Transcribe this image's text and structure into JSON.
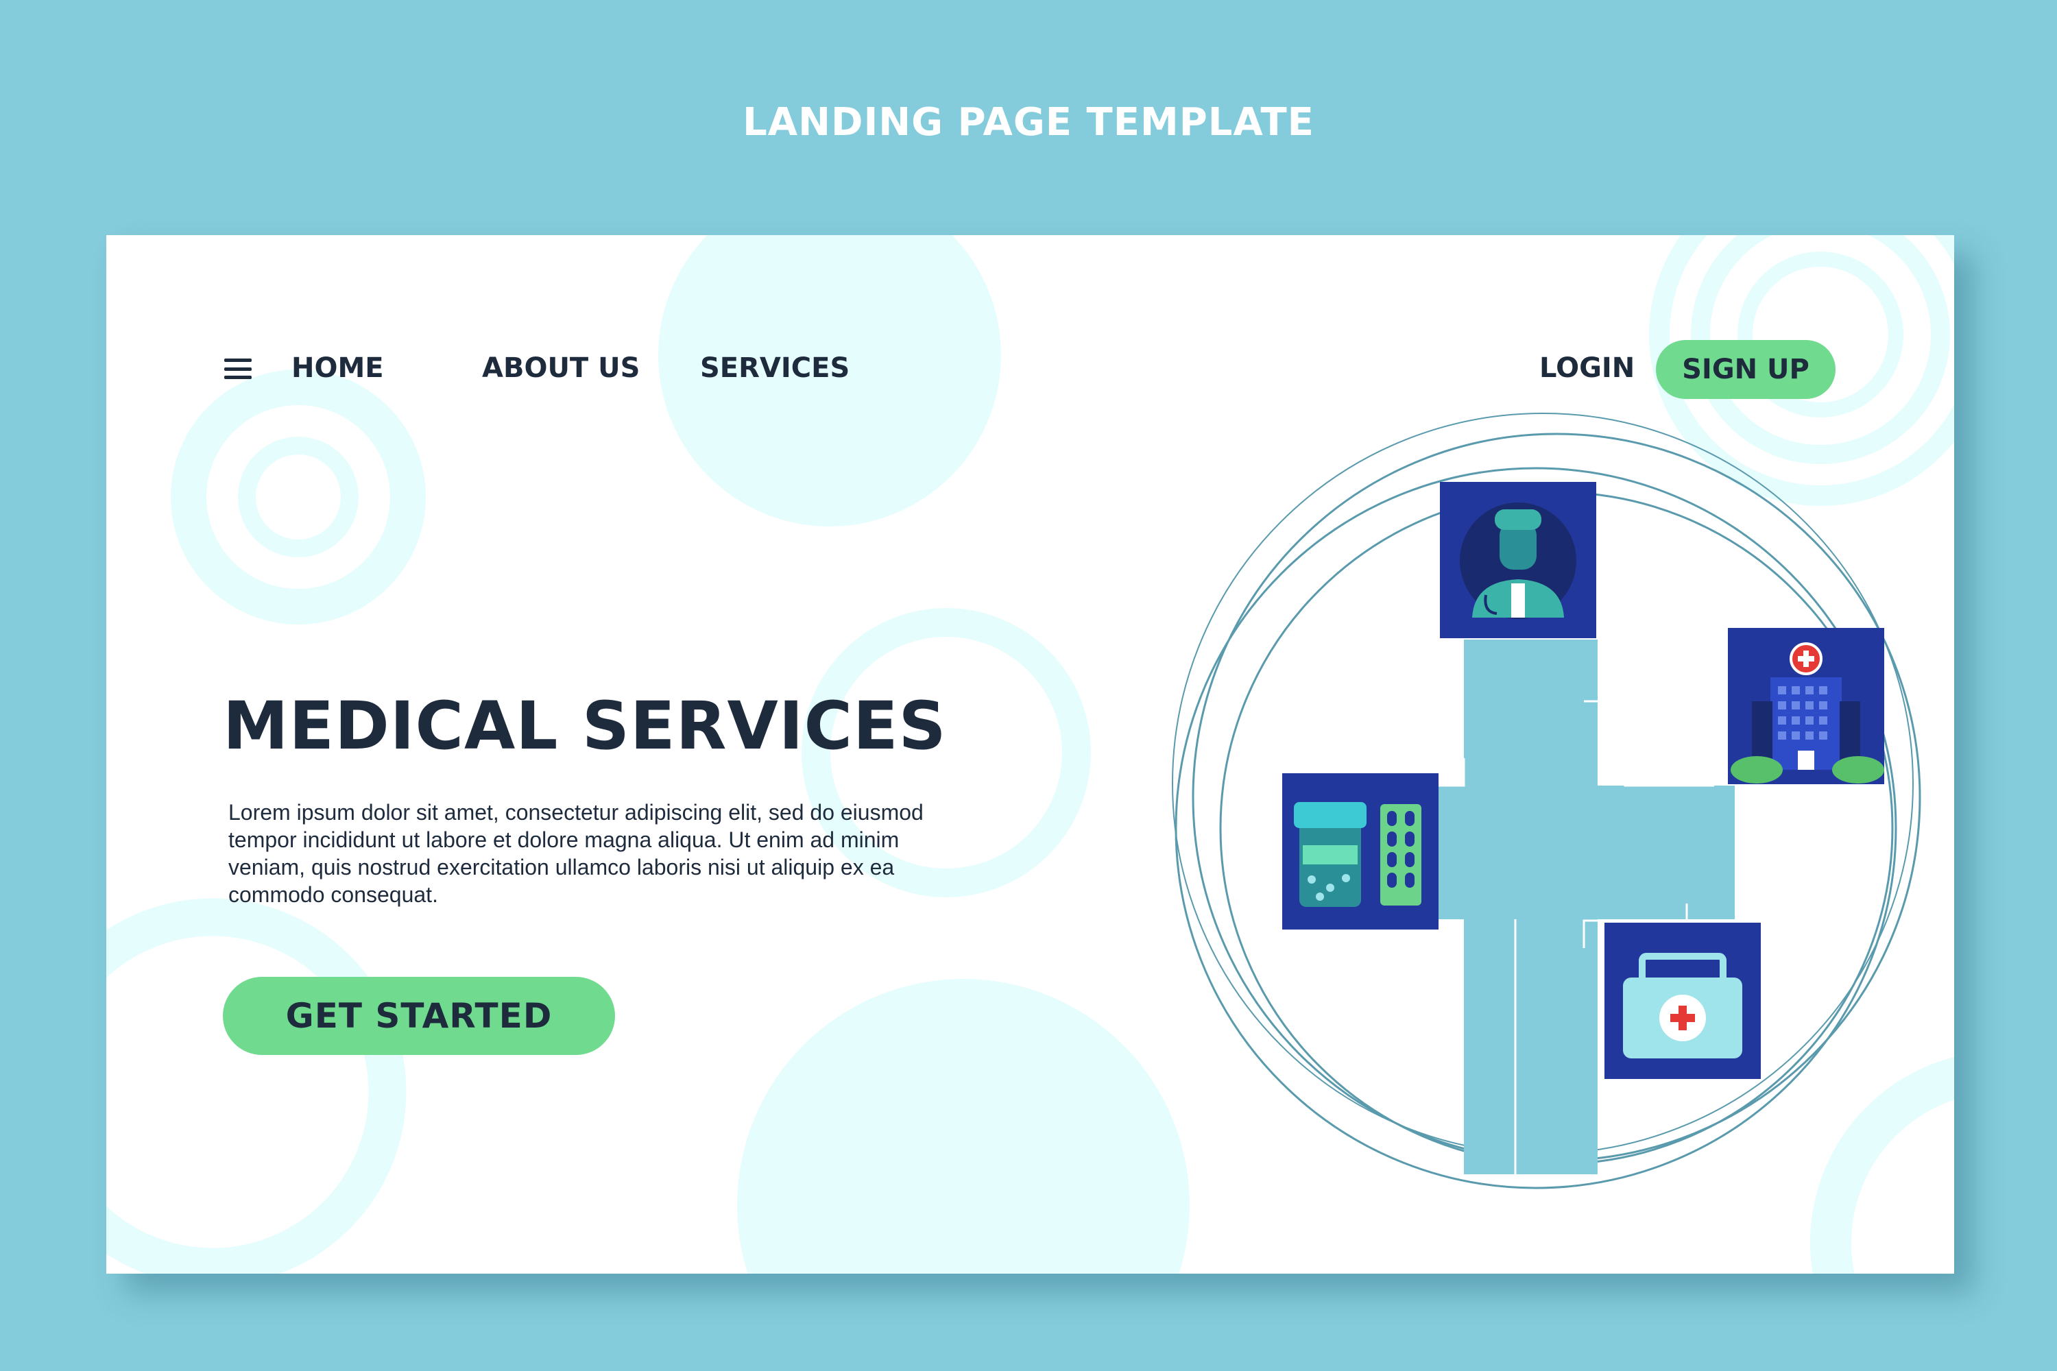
{
  "page": {
    "title": "LANDING PAGE TEMPLATE"
  },
  "nav": {
    "menu_icon": "hamburger-menu-icon",
    "links": [
      "HOME",
      "ABOUT US",
      "SERVICES"
    ],
    "login": "LOGIN",
    "signup": "SIGN UP"
  },
  "hero": {
    "title": "MEDICAL SERVICES",
    "description": "Lorem ipsum dolor sit amet, consectetur adipiscing elit, sed do eiusmod tempor incididunt ut labore et dolore magna aliqua. Ut enim ad minim veniam, quis nostrud exercitation ullamco laboris nisi ut aliquip ex ea commodo consequat.",
    "cta": "GET STARTED"
  },
  "illustration": {
    "icons": [
      "doctor-icon",
      "hospital-icon",
      "medicine-icon",
      "first-aid-kit-icon"
    ]
  },
  "colors": {
    "background": "#84cbdb",
    "card": "#ffffff",
    "accent_green": "#70db8f",
    "text_dark": "#1e2b3d",
    "icon_tile": "#22379b",
    "light_circle": "#e6fdfd"
  }
}
